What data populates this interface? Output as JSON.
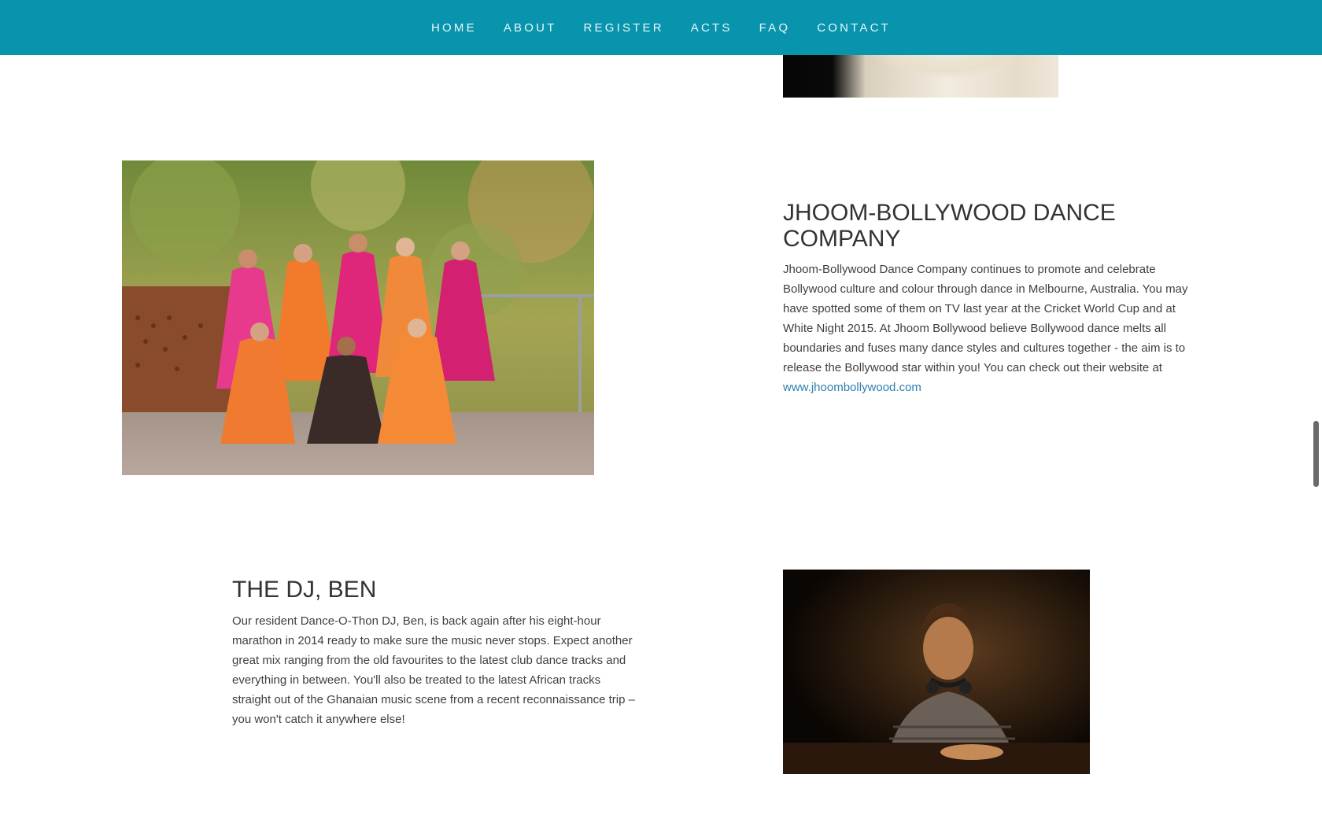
{
  "nav": {
    "items": [
      {
        "label": "HOME"
      },
      {
        "label": "ABOUT"
      },
      {
        "label": "REGISTER"
      },
      {
        "label": "ACTS"
      },
      {
        "label": "FAQ"
      },
      {
        "label": "CONTACT"
      }
    ]
  },
  "acts": [
    {
      "title": "JHOOM-BOLLYWOOD DANCE COMPANY",
      "description": "Jhoom-Bollywood Dance Company continues to promote and celebrate Bollywood culture and colour through dance in Melbourne, Australia. You may have spotted some of them on TV last year at the Cricket World Cup and at White Night 2015. At Jhoom Bollywood believe Bollywood dance melts all boundaries and fuses many dance styles and cultures together - the aim is to release the Bollywood star within you! You can check out their website at ",
      "link_text": "www.jhoombollywood.com"
    },
    {
      "title": "THE DJ, BEN",
      "description": "Our resident Dance-O-Thon DJ, Ben, is back again after his eight-hour marathon in 2014 ready to make sure the music never stops. Expect another great mix ranging from the old favourites to the latest club dance tracks and everything in between. You'll also be treated to the latest African tracks straight out of the Ghanaian music scene from a recent reconnaissance trip – you won't catch it anywhere else!"
    }
  ],
  "colors": {
    "navbar": "#0894ad",
    "link": "#2f7fb0",
    "heading": "#333333"
  }
}
